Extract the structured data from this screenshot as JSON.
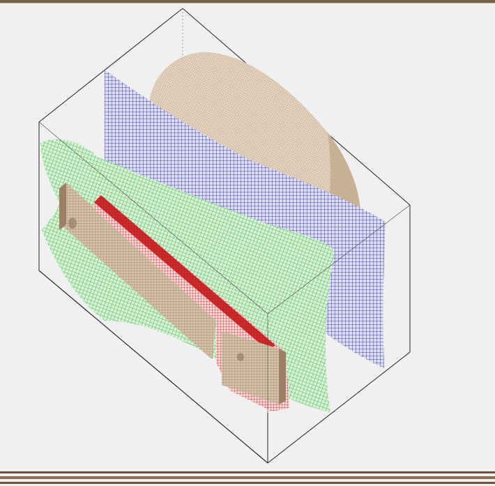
{
  "window": {
    "frame_color": "#7a6048",
    "background": "#f0f0f0"
  },
  "scene": {
    "meshes": [
      {
        "name": "disc",
        "color": "#c8b49a"
      },
      {
        "name": "blue-surface",
        "color": "#1a1aa8"
      },
      {
        "name": "green-surface",
        "color": "#22b022"
      },
      {
        "name": "red-part",
        "color": "#d41a1a"
      },
      {
        "name": "plate",
        "color": "#a89070"
      }
    ]
  }
}
